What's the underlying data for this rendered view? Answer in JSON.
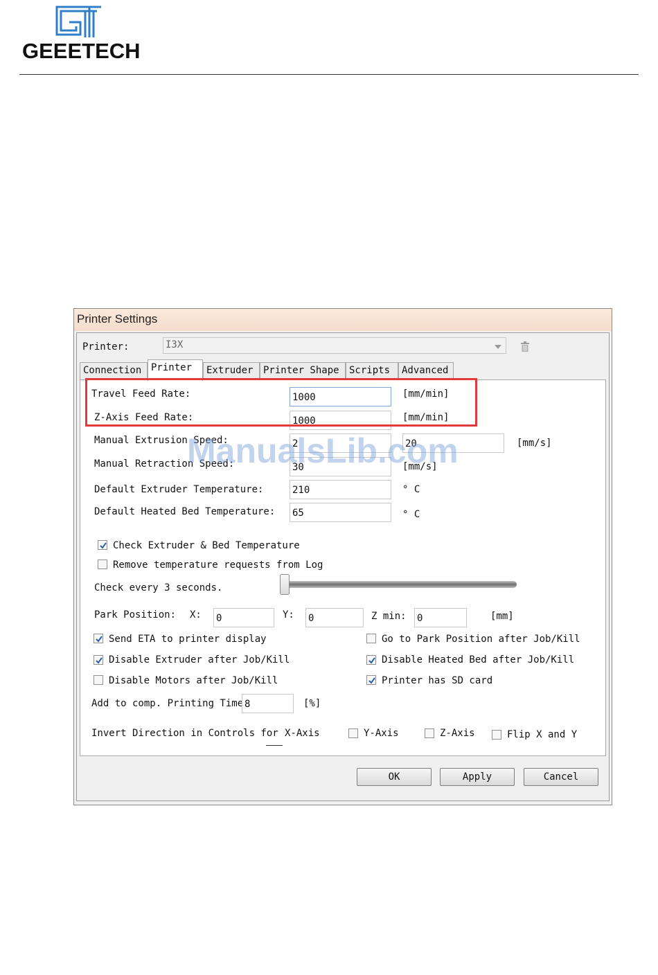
{
  "header": {
    "brand": "GEEETECH"
  },
  "window": {
    "title": "Printer Settings",
    "printer_label": "Printer:",
    "printer_value": "I3X",
    "tabs": [
      {
        "label": "Connection"
      },
      {
        "label": "Printer",
        "active": true
      },
      {
        "label": "Extruder"
      },
      {
        "label": "Printer Shape"
      },
      {
        "label": "Scripts"
      },
      {
        "label": "Advanced"
      }
    ],
    "rows": {
      "travel_feed_rate": {
        "label": "Travel Feed Rate:",
        "value": "1000",
        "unit": "[mm/min]"
      },
      "z_feed_rate": {
        "label": "Z-Axis Feed Rate:",
        "value": "1000",
        "unit": "[mm/min]"
      },
      "manual_extrusion": {
        "label": "Manual Extrusion Speed:",
        "value1": "2",
        "value2": "20",
        "unit": "[mm/s]"
      },
      "manual_retraction": {
        "label": "Manual Retraction Speed:",
        "value": "30",
        "unit": "[mm/s]"
      },
      "extruder_temp": {
        "label": "Default Extruder Temperature:",
        "value": "210",
        "unit": "° C"
      },
      "bed_temp": {
        "label": "Default Heated Bed Temperature:",
        "value": "65",
        "unit": "° C"
      }
    },
    "checks": {
      "check_temp": {
        "label": "Check Extruder & Bed Temperature",
        "checked": true
      },
      "remove_requests": {
        "label": "Remove temperature requests from Log",
        "checked": false
      },
      "check_every": "Check every 3 seconds.",
      "send_eta": {
        "label": "Send ETA to printer display",
        "checked": true
      },
      "goto_park": {
        "label": "Go to Park Position after Job/Kill",
        "checked": false
      },
      "disable_extruder": {
        "label": "Disable Extruder after Job/Kill",
        "checked": true
      },
      "disable_bed": {
        "label": "Disable Heated Bed after Job/Kill",
        "checked": true
      },
      "disable_motors": {
        "label": "Disable Motors after Job/Kill",
        "checked": false
      },
      "sd_card": {
        "label": "Printer has SD card",
        "checked": true
      }
    },
    "park": {
      "label": "Park Position:",
      "x_label": "X:",
      "x": "0",
      "y_label": "Y:",
      "y": "0",
      "z_label": "Z min:",
      "z": "0",
      "unit": "[mm]"
    },
    "comp": {
      "label": "Add to comp. Printing Time",
      "value": "8",
      "unit": "[%]"
    },
    "invert": {
      "label": "Invert Direction in Controls for",
      "x": "X-Axis",
      "y": "Y-Axis",
      "z": "Z-Axis",
      "flip": "Flip X and Y"
    },
    "buttons": {
      "ok": "OK",
      "apply": "Apply",
      "cancel": "Cancel"
    }
  },
  "watermark": "ManualsLib.com",
  "colors": {
    "highlight": "#e23a3a",
    "logo_blue": "#2f7fc8"
  }
}
